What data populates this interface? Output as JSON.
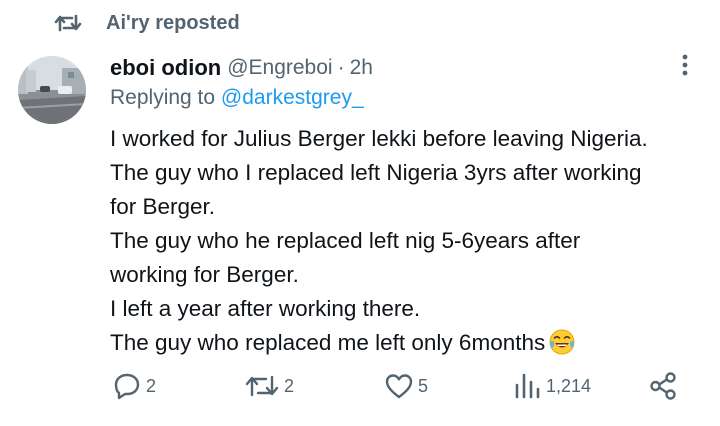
{
  "repost": {
    "label": "Ai'ry reposted",
    "icon": "repost-icon"
  },
  "post": {
    "author_name": "eboi odion",
    "author_handle": "@Engreboi",
    "separator": "·",
    "time": "2h",
    "replying_prefix": "Replying to",
    "replying_handle": "@darkestgrey_",
    "lines": [
      "I worked for Julius Berger lekki before leaving Nigeria.",
      "The guy who I replaced left Nigeria 3yrs after working",
      "for Berger.",
      "The guy who he replaced left nig 5-6years after",
      "working for Berger.",
      "I left a year after working there.",
      "The guy who replaced me left only 6months"
    ],
    "emoji": "face-with-tears-of-joy"
  },
  "actions": {
    "replies": "2",
    "reposts": "2",
    "likes": "5",
    "views": "1,214"
  },
  "colors": {
    "text": "#0f1419",
    "muted": "#536471",
    "link": "#1d9bf0"
  }
}
